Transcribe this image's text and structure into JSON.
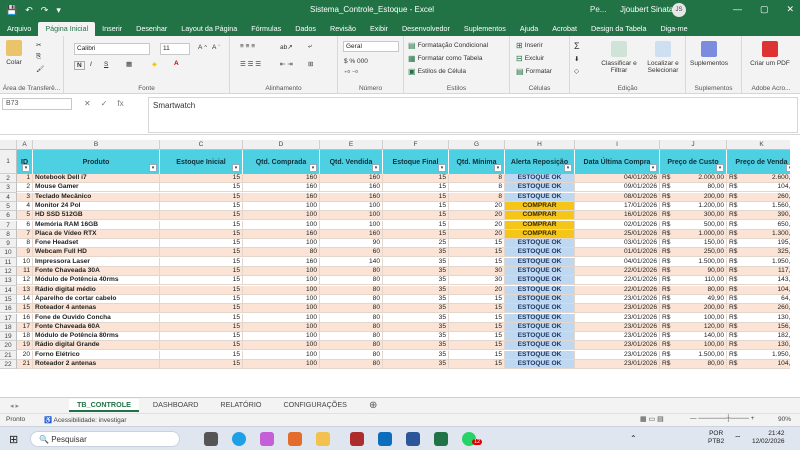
{
  "titlebar": {
    "autosave": "AutoSave",
    "title": "Sistema_Controle_Estoque  -  Excel",
    "search": "Pe...",
    "user": "Jjoubert Sinata",
    "avatar": "JS",
    "min": "—",
    "max": "▢",
    "close": "✕"
  },
  "tabs": [
    "Arquivo",
    "Página Inicial",
    "Inserir",
    "Desenhar",
    "Layout da Página",
    "Fórmulas",
    "Dados",
    "Revisão",
    "Exibir",
    "Desenvolvedor",
    "Suplementos",
    "Ajuda",
    "Acrobat",
    "Design da Tabela",
    "Diga-me"
  ],
  "ribbon": {
    "clipboard": {
      "paste": "Colar",
      "label": "Área de Transferê..."
    },
    "font": {
      "name": "Calibri",
      "size": "11",
      "bold": "N",
      "italic": "I",
      "underline": "S",
      "label": "Fonte"
    },
    "alignment": {
      "label": "Alinhamento"
    },
    "number": {
      "format": "Geral",
      "label": "Número"
    },
    "styles": {
      "cond": "Formatação Condicional",
      "table": "Formatar como Tabela",
      "cell": "Estilos de Célula",
      "label": "Estilos"
    },
    "cells": {
      "insert": "Inserir",
      "delete": "Excluir",
      "format": "Formatar",
      "label": "Células"
    },
    "editing": {
      "sort": "Classificar e Filtrar",
      "find": "Localizar e Selecionar",
      "label": "Edição"
    },
    "addins": {
      "btn": "Suplementos",
      "label": "Suplementos"
    },
    "acrobat": {
      "btn": "Criar um PDF",
      "label": "Adobe Acro..."
    }
  },
  "formula_bar": {
    "name_box": "B73",
    "value": "Smartwatch"
  },
  "columns": [
    "A",
    "B",
    "C",
    "D",
    "E",
    "F",
    "G",
    "H",
    "I",
    "J",
    "K"
  ],
  "headers": [
    "ID",
    "Produto",
    "Estoque Inicial",
    "Qtd. Comprada",
    "Qtd. Vendida",
    "Estoque Final",
    "Qtd. Mínima",
    "Alerta Reposição",
    "Data Última Compra",
    "Preço de Custo",
    "Preço de Venda"
  ],
  "row_numbers": [
    "1",
    "2",
    "3",
    "4",
    "5",
    "6",
    "7",
    "8",
    "9",
    "10",
    "11",
    "12",
    "13",
    "14",
    "15",
    "16",
    "17",
    "18",
    "19",
    "20",
    "21",
    "22"
  ],
  "rows": [
    {
      "id": "1",
      "produto": "Notebook Dell i7",
      "ini": "15",
      "comp": "160",
      "vend": "160",
      "fin": "15",
      "min": "8",
      "alerta": "ESTOQUE OK",
      "data": "04/01/2026",
      "custo": "2.000,00",
      "venda": "2.600,0"
    },
    {
      "id": "2",
      "produto": "Mouse Gamer",
      "ini": "15",
      "comp": "160",
      "vend": "160",
      "fin": "15",
      "min": "8",
      "alerta": "ESTOQUE OK",
      "data": "09/01/2026",
      "custo": "80,00",
      "venda": "104,0"
    },
    {
      "id": "3",
      "produto": "Teclado Mecânico",
      "ini": "15",
      "comp": "160",
      "vend": "160",
      "fin": "15",
      "min": "8",
      "alerta": "ESTOQUE OK",
      "data": "08/01/2026",
      "custo": "200,00",
      "venda": "260,0"
    },
    {
      "id": "4",
      "produto": "Monitor 24 Pol",
      "ini": "15",
      "comp": "100",
      "vend": "100",
      "fin": "15",
      "min": "20",
      "alerta": "COMPRAR",
      "data": "17/01/2026",
      "custo": "1.200,00",
      "venda": "1.560,0"
    },
    {
      "id": "5",
      "produto": "HD SSD 512GB",
      "ini": "15",
      "comp": "100",
      "vend": "100",
      "fin": "15",
      "min": "20",
      "alerta": "COMPRAR",
      "data": "16/01/2026",
      "custo": "300,00",
      "venda": "390,0"
    },
    {
      "id": "6",
      "produto": "Memória RAM 16GB",
      "ini": "15",
      "comp": "100",
      "vend": "100",
      "fin": "15",
      "min": "20",
      "alerta": "COMPRAR",
      "data": "02/01/2026",
      "custo": "500,00",
      "venda": "650,0"
    },
    {
      "id": "7",
      "produto": "Placa de Vídeo RTX",
      "ini": "15",
      "comp": "160",
      "vend": "160",
      "fin": "15",
      "min": "20",
      "alerta": "COMPRAR",
      "data": "25/01/2026",
      "custo": "1.000,00",
      "venda": "1.300,0"
    },
    {
      "id": "8",
      "produto": "Fone Headset",
      "ini": "15",
      "comp": "100",
      "vend": "90",
      "fin": "25",
      "min": "15",
      "alerta": "ESTOQUE OK",
      "data": "03/01/2026",
      "custo": "150,00",
      "venda": "195,0"
    },
    {
      "id": "9",
      "produto": "Webcam Full HD",
      "ini": "15",
      "comp": "80",
      "vend": "60",
      "fin": "35",
      "min": "15",
      "alerta": "ESTOQUE OK",
      "data": "01/01/2026",
      "custo": "250,00",
      "venda": "325,0"
    },
    {
      "id": "10",
      "produto": "Impressora Laser",
      "ini": "15",
      "comp": "160",
      "vend": "140",
      "fin": "35",
      "min": "15",
      "alerta": "ESTOQUE OK",
      "data": "04/01/2026",
      "custo": "1.500,00",
      "venda": "1.950,0"
    },
    {
      "id": "11",
      "produto": "Fonte Chaveada 30A",
      "ini": "15",
      "comp": "100",
      "vend": "80",
      "fin": "35",
      "min": "30",
      "alerta": "ESTOQUE OK",
      "data": "22/01/2026",
      "custo": "90,00",
      "venda": "117,0"
    },
    {
      "id": "12",
      "produto": "Módulo de Potência 40rms",
      "ini": "15",
      "comp": "100",
      "vend": "80",
      "fin": "35",
      "min": "30",
      "alerta": "ESTOQUE OK",
      "data": "22/01/2026",
      "custo": "110,00",
      "venda": "143,0"
    },
    {
      "id": "13",
      "produto": "Rádio digital médio",
      "ini": "15",
      "comp": "100",
      "vend": "80",
      "fin": "35",
      "min": "20",
      "alerta": "ESTOQUE OK",
      "data": "22/01/2026",
      "custo": "80,00",
      "venda": "104,0"
    },
    {
      "id": "14",
      "produto": "Aparelho de cortar cabelo",
      "ini": "15",
      "comp": "100",
      "vend": "80",
      "fin": "35",
      "min": "15",
      "alerta": "ESTOQUE OK",
      "data": "23/01/2026",
      "custo": "49,90",
      "venda": "64,8"
    },
    {
      "id": "15",
      "produto": "Roteador 4 antenas",
      "ini": "15",
      "comp": "100",
      "vend": "80",
      "fin": "35",
      "min": "15",
      "alerta": "ESTOQUE OK",
      "data": "23/01/2026",
      "custo": "200,00",
      "venda": "260,0"
    },
    {
      "id": "16",
      "produto": "Fone de Ouvido Concha",
      "ini": "15",
      "comp": "100",
      "vend": "80",
      "fin": "35",
      "min": "15",
      "alerta": "ESTOQUE OK",
      "data": "23/01/2026",
      "custo": "100,00",
      "venda": "130,0"
    },
    {
      "id": "17",
      "produto": "Fonte Chaveada 60A",
      "ini": "15",
      "comp": "100",
      "vend": "80",
      "fin": "35",
      "min": "15",
      "alerta": "ESTOQUE OK",
      "data": "23/01/2026",
      "custo": "120,00",
      "venda": "156,0"
    },
    {
      "id": "18",
      "produto": "Módulo de Potência 80rms",
      "ini": "15",
      "comp": "100",
      "vend": "80",
      "fin": "35",
      "min": "15",
      "alerta": "ESTOQUE OK",
      "data": "23/01/2026",
      "custo": "140,00",
      "venda": "182,0"
    },
    {
      "id": "19",
      "produto": "Rádio digital Grande",
      "ini": "15",
      "comp": "100",
      "vend": "80",
      "fin": "35",
      "min": "15",
      "alerta": "ESTOQUE OK",
      "data": "23/01/2026",
      "custo": "100,00",
      "venda": "130,0"
    },
    {
      "id": "20",
      "produto": "Forno Elétrico",
      "ini": "15",
      "comp": "100",
      "vend": "80",
      "fin": "35",
      "min": "15",
      "alerta": "ESTOQUE OK",
      "data": "23/01/2026",
      "custo": "1.500,00",
      "venda": "1.950,0"
    },
    {
      "id": "21",
      "produto": "Roteador 2 antenas",
      "ini": "15",
      "comp": "100",
      "vend": "80",
      "fin": "35",
      "min": "15",
      "alerta": "ESTOQUE OK",
      "data": "23/01/2026",
      "custo": "80,00",
      "venda": "104,0"
    }
  ],
  "currency": "R$",
  "sheets": [
    "TB_CONTROLE",
    "DASHBOARD",
    "RELATÓRIO",
    "CONFIGURAÇÕES"
  ],
  "status": {
    "ready": "Pronto",
    "accessibility": "Acessibilidade: investigar",
    "zoom": "90%"
  },
  "taskbar": {
    "search": "Pesquisar",
    "lang": "POR",
    "layout": "PTB2",
    "time": "21:42",
    "date": "12/02/2026",
    "badge": "12"
  },
  "colors": {
    "excel_green": "#217346",
    "header_cyan": "#4dd0e1",
    "row_alt": "#fbe4d5",
    "ok": "#bfd8f2",
    "buy": "#f5c518"
  }
}
